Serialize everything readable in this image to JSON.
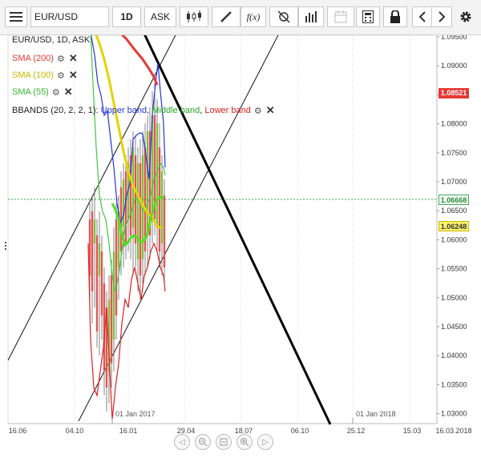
{
  "toolbar": {
    "menu_icon": "hamburger-menu-icon",
    "symbol_value": "EUR/USD",
    "timeframe": "1D",
    "price_type": "ASK",
    "icons": [
      "candlestick-icon",
      "draw-pencil-icon",
      "function-icon",
      "crosshair-off-icon",
      "volume-bars-icon",
      "calendar-icon",
      "calculator-icon",
      "lock-icon",
      "chevron-left-icon",
      "chevron-right-icon",
      "gear-icon"
    ],
    "fx_label": "f(x)"
  },
  "chart": {
    "header": "EUR/USD, 1D, ASK",
    "indicators": [
      {
        "label": "SMA (200)",
        "color": "#e53935"
      },
      {
        "label": "SMA (100)",
        "color": "#e6d200"
      },
      {
        "label": "SMA (55)",
        "color": "#43c443"
      }
    ],
    "bbands": {
      "prefix": "BBANDS (20, 2, 2, 1): ",
      "upper": "Upper band",
      "middle": "Middle band",
      "lower": "Lower band",
      "sep": ", "
    },
    "price_axis": [
      "1.09500",
      "1.09000",
      "1.08500",
      "1.08000",
      "1.07500",
      "1.07000",
      "1.06500",
      "1.06000",
      "1.05500",
      "1.05000",
      "1.04500",
      "1.04000",
      "1.03500",
      "1.03000"
    ],
    "price_tags": {
      "sma200": {
        "value": "1.08521",
        "bg": "#e53935",
        "fg": "#ffffff"
      },
      "current": {
        "value": "1.06668",
        "bg": "#ffffff",
        "fg": "#228833",
        "border": "#35a853"
      },
      "sma100": {
        "value": "1.06248",
        "bg": "#fff36b",
        "fg": "#333333"
      }
    },
    "time_axis": [
      "16.06",
      "04.10",
      "16.01",
      "29.04",
      "18.07",
      "06.10",
      "25.12",
      "15.03",
      "16.03.2018"
    ],
    "year_markers": [
      "01 Jan 2017",
      "01 Jan 2018"
    ],
    "nav_icons": [
      "scroll-left-icon",
      "zoom-out-icon",
      "zoom-fit-icon",
      "zoom-in-icon",
      "scroll-right-icon"
    ]
  }
}
